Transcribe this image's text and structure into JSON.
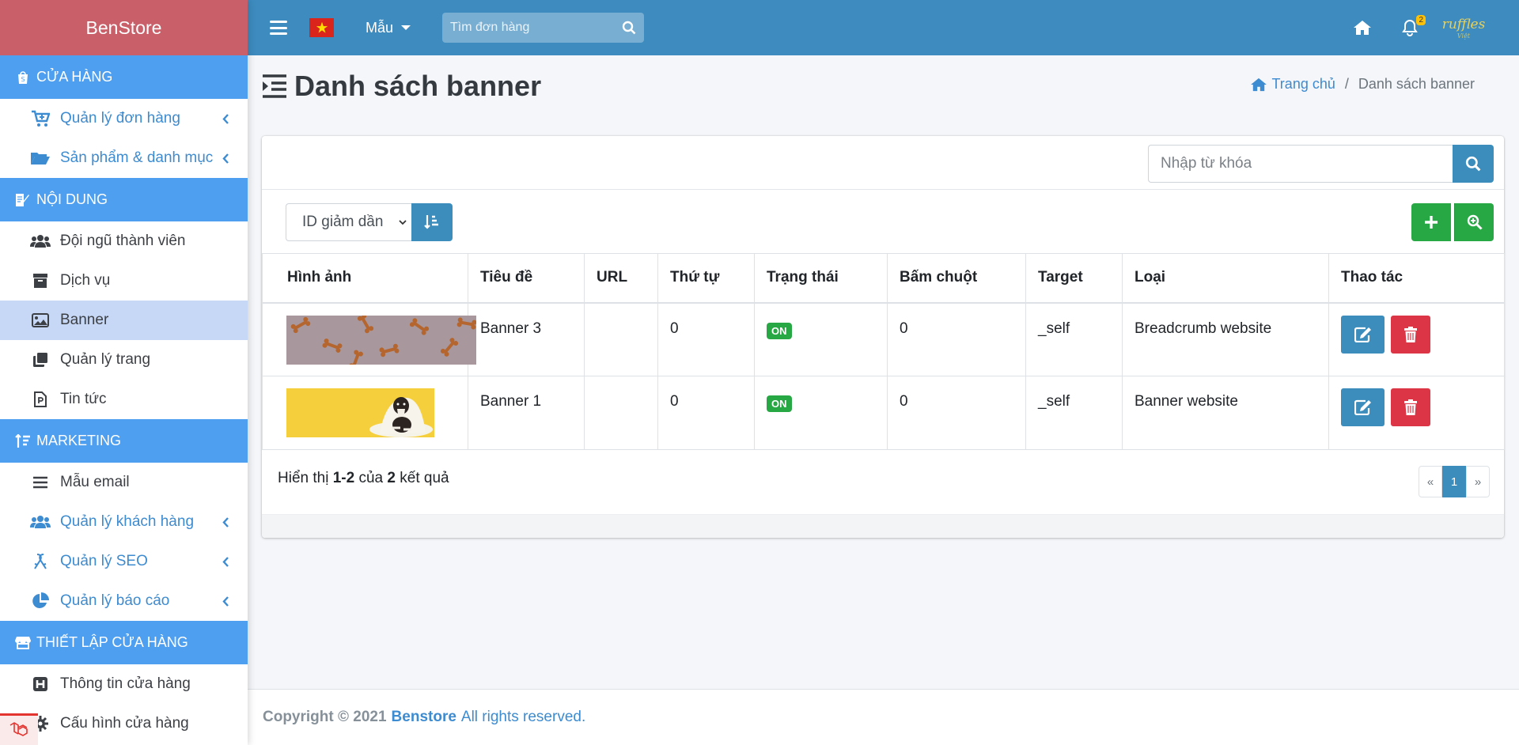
{
  "brand": "BenStore",
  "topbar": {
    "menu_label": "Mẫu",
    "search_placeholder": "Tìm đơn hàng",
    "notification_count": "2",
    "logo_text": "ruffles",
    "logo_sub": "Việt"
  },
  "sidebar": {
    "sections": [
      {
        "title": "CỬA HÀNG",
        "icon": "shopify-bag-icon"
      },
      {
        "title": "NỘI DUNG",
        "icon": "edit-document-icon"
      },
      {
        "title": "MARKETING",
        "icon": "sort-amount-icon"
      },
      {
        "title": "THIẾT LẬP CỬA HÀNG",
        "icon": "store-icon"
      }
    ],
    "items": [
      {
        "label": "Quản lý đơn hàng",
        "icon": "cart-plus-icon",
        "has_submenu": true
      },
      {
        "label": "Sản phẩm & danh mục",
        "icon": "folder-open-icon",
        "has_submenu": true
      },
      {
        "label": "Đội ngũ thành viên",
        "icon": "users-icon",
        "has_submenu": false
      },
      {
        "label": "Dịch vụ",
        "icon": "archive-icon",
        "has_submenu": false
      },
      {
        "label": "Banner",
        "icon": "image-icon",
        "has_submenu": false,
        "active": true
      },
      {
        "label": "Quản lý trang",
        "icon": "clone-icon",
        "has_submenu": false
      },
      {
        "label": "Tin tức",
        "icon": "file-p-icon",
        "has_submenu": false
      },
      {
        "label": "Mẫu email",
        "icon": "bars-icon",
        "has_submenu": false
      },
      {
        "label": "Quản lý khách hàng",
        "icon": "users-icon",
        "has_submenu": true
      },
      {
        "label": "Quản lý SEO",
        "icon": "ribbon-icon",
        "has_submenu": true
      },
      {
        "label": "Quản lý báo cáo",
        "icon": "pie-chart-icon",
        "has_submenu": true
      },
      {
        "label": "Thông tin cửa hàng",
        "icon": "h-square-icon",
        "has_submenu": false
      },
      {
        "label": "Cấu hình cửa hàng",
        "icon": "gear-icon",
        "has_submenu": false
      }
    ]
  },
  "page": {
    "title": "Danh sách banner",
    "breadcrumb_home": "Trang chủ",
    "breadcrumb_sep": "/",
    "breadcrumb_current": "Danh sách banner"
  },
  "card": {
    "keyword_placeholder": "Nhập từ khóa",
    "sort_selected": "ID giảm dần",
    "columns": [
      "Hình ảnh",
      "Tiêu đề",
      "URL",
      "Thứ tự",
      "Trạng thái",
      "Bấm chuột",
      "Target",
      "Loại",
      "Thao tác"
    ],
    "rows": [
      {
        "title": "Banner 3",
        "url": "",
        "order": "0",
        "status": "ON",
        "clicks": "0",
        "target": "_self",
        "type": "Breadcrumb website",
        "image": "bones-pattern"
      },
      {
        "title": "Banner 1",
        "url": "",
        "order": "0",
        "status": "ON",
        "clicks": "0",
        "target": "_self",
        "type": "Banner website",
        "image": "dog-on-yellow"
      }
    ],
    "summary_prefix": "Hiển thị",
    "summary_range_from": "1",
    "summary_range_dash": "-",
    "summary_range_to": "2",
    "summary_mid": "của",
    "summary_total": "2",
    "summary_suffix": "kết quả",
    "pager": [
      "«",
      "1",
      "»"
    ]
  },
  "footer": {
    "copyright": "Copyright © 2021",
    "brand_link": "Benstore",
    "rights": "All rights reserved."
  },
  "colors": {
    "brand_bg": "#c95f68",
    "topbar": "#3d8bbf",
    "section_header": "#4e9ff0",
    "primary": "#3c8dbc",
    "success": "#28a745",
    "danger": "#dc3545"
  }
}
